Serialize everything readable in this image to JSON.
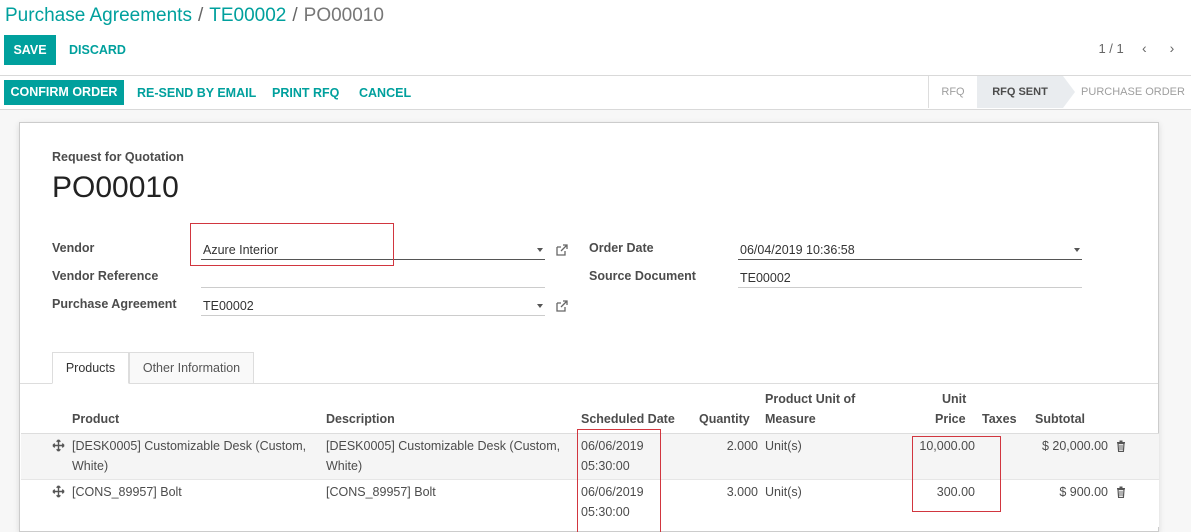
{
  "breadcrumb": {
    "root": "Purchase Agreements",
    "parent": "TE00002",
    "current": "PO00010",
    "sep": "/"
  },
  "buttons": {
    "save": "SAVE",
    "discard": "DISCARD"
  },
  "pager": {
    "text": "1 / 1"
  },
  "actions": {
    "confirm": "CONFIRM ORDER",
    "resend": "RE-SEND BY EMAIL",
    "print": "PRINT RFQ",
    "cancel": "CANCEL"
  },
  "status": {
    "rfq": "RFQ",
    "rfq_sent": "RFQ SENT",
    "purchase_order": "PURCHASE ORDER"
  },
  "form": {
    "doc_type": "Request for Quotation",
    "name": "PO00010",
    "vendor_label": "Vendor",
    "vendor_value": "Azure Interior",
    "vendor_ref_label": "Vendor Reference",
    "vendor_ref_value": "",
    "agreement_label": "Purchase Agreement",
    "agreement_value": "TE00002",
    "order_date_label": "Order Date",
    "order_date_value": "06/04/2019 10:36:58",
    "source_label": "Source Document",
    "source_value": "TE00002"
  },
  "tabs": {
    "products": "Products",
    "other": "Other Information"
  },
  "table": {
    "headers": {
      "product": "Product",
      "description": "Description",
      "scheduled": "Scheduled Date",
      "quantity": "Quantity",
      "uom_1": "Product Unit of",
      "uom_2": "Measure",
      "price_1": "Unit",
      "price_2": "Price",
      "taxes": "Taxes",
      "subtotal": "Subtotal"
    },
    "rows": [
      {
        "product_1": "[DESK0005] Customizable Desk (Custom,",
        "product_2": "White)",
        "desc_1": "[DESK0005] Customizable Desk (Custom,",
        "desc_2": "White)",
        "date_1": "06/06/2019",
        "date_2": "05:30:00",
        "qty": "2.000",
        "uom": "Unit(s)",
        "price": "10,000.00",
        "subtotal": "$ 20,000.00"
      },
      {
        "product_1": "[CONS_89957] Bolt",
        "desc_1": "[CONS_89957] Bolt",
        "date_1": "06/06/2019",
        "date_2": "05:30:00",
        "qty": "3.000",
        "uom": "Unit(s)",
        "price": "300.00",
        "subtotal": "$ 900.00"
      }
    ]
  },
  "colors": {
    "accent": "#00A09D",
    "highlight": "#d1363f"
  }
}
